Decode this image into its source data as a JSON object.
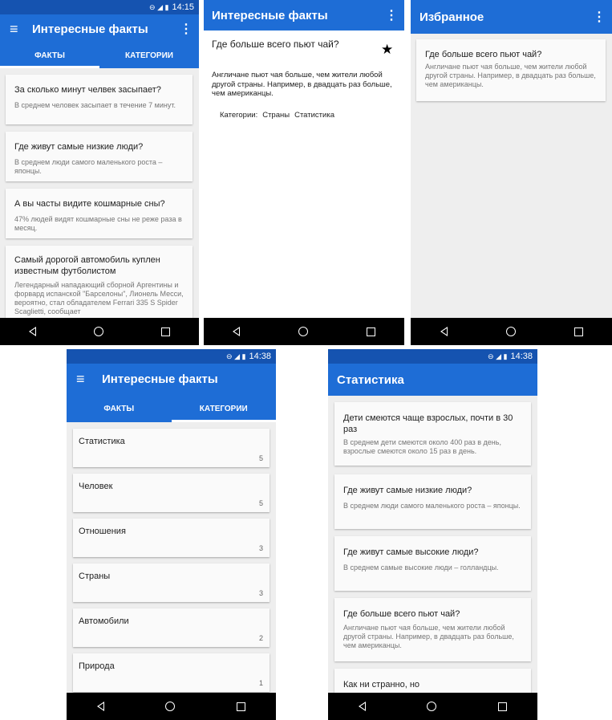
{
  "colors": {
    "status_bar": "#1553b0",
    "app_bar": "#1e6dd6",
    "nav_bar": "#000000",
    "background": "#eeeeee",
    "card": "#fafafa"
  },
  "screen1": {
    "time": "14:15",
    "title": "Интересные факты",
    "tabs": [
      "ФАКТЫ",
      "КАТЕГОРИИ"
    ],
    "facts": [
      {
        "q": "За сколько минут челвек засыпает?",
        "a": "В среднем человек засыпает в течение 7 минут."
      },
      {
        "q": "Где живут самые низкие люди?",
        "a": "В среднем люди самого маленького роста – японцы."
      },
      {
        "q": "А вы часты видите кошмарные сны?",
        "a": "47% людей видят кошмарные сны не реже раза в месяц."
      },
      {
        "q": "Самый дорогой автомобиль куплен известным футболистом",
        "a": "Легендарный нападающий сборной Аргентины и форвард испанской \"Барселоны\", Лионель Месси, вероятно, стал обладателем Ferrari 335 S Spider Scaglietti, сообщает"
      }
    ]
  },
  "screen2": {
    "title": "Интересные факты",
    "question": "Где больше всего пьют чай?",
    "answer": "Англичане пьют чая больше, чем жители любой другой страны. Например, в двадцать раз больше, чем американцы.",
    "categories_label": "Категории:",
    "categories": [
      "Страны",
      "Статистика"
    ],
    "star_icon": "★"
  },
  "screen3": {
    "title": "Избранное",
    "fact": {
      "q": "Где больше всего пьют чай?",
      "a": "Англичане пьют чая больше, чем жители любой другой страны. Например, в двадцать раз больше, чем американцы."
    }
  },
  "screen4": {
    "time": "14:38",
    "title": "Интересные факты",
    "tabs": [
      "ФАКТЫ",
      "КАТЕГОРИИ"
    ],
    "categories": [
      {
        "name": "Статистика",
        "count": "5"
      },
      {
        "name": "Человек",
        "count": "5"
      },
      {
        "name": "Отношения",
        "count": "3"
      },
      {
        "name": "Страны",
        "count": "3"
      },
      {
        "name": "Автомобили",
        "count": "2"
      },
      {
        "name": "Природа",
        "count": "1"
      }
    ]
  },
  "screen5": {
    "time": "14:38",
    "title": "Статистика",
    "facts": [
      {
        "q": "Дети смеются чаще взрослых, почти в 30 раз",
        "a": "В среднем дети смеются около 400 раз в день, взрослые смеются около 15 раз в день."
      },
      {
        "q": "Где живут самые низкие люди?",
        "a": "В среднем люди самого маленького роста – японцы."
      },
      {
        "q": "Где живут самые высокие люди?",
        "a": "В среднем самые высокие люди – голландцы."
      },
      {
        "q": "Где больше всего пьют чай?",
        "a": "Англичане пьют чая больше, чем жители любой другой страны. Например, в двадцать раз больше, чем американцы."
      },
      {
        "q": "Как ни странно, но",
        "a": ""
      }
    ]
  }
}
